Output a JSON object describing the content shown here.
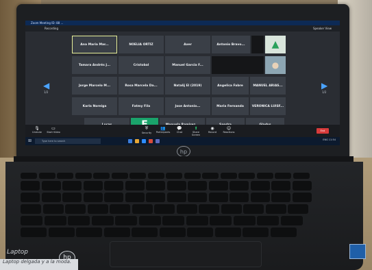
{
  "zoom": {
    "window_title": "Zoom Meeting ID: 88 ...",
    "recording_label": "Recording",
    "speaker_view_label": "Speaker View",
    "page_left": "1/2",
    "page_right": "1/2",
    "participants": [
      "Ana Maria Mar...",
      "NOELIA ORTIZ",
      "Axer",
      "Antonio Bravo...",
      "Tamara Andrés J...",
      "Cristobal",
      "Manuel Garcia F...",
      "Jorge Marcelo M...",
      "Rosa Marcela Da...",
      "Natalij El (2019)",
      "Angelica Fabre",
      "MANUEL ARIAS...",
      "Karla Noreiga",
      "Fatmy Fila",
      "Jose Antonio...",
      "Maria Fernanda",
      "VERONICA LUISF...",
      "Lucas",
      "E",
      "Manuela Ramirez...",
      "Sandra",
      "Gladys"
    ],
    "controls": [
      "Unmute",
      "Start Video",
      "Security",
      "Participants",
      "Chat",
      "Share Screen",
      "Record",
      "Reactions"
    ],
    "end_label": "End",
    "taskbar_search": "Type here to search",
    "tray_time": "ENG 11:54"
  },
  "laptop": {
    "brand_label": "Laptop",
    "sticker_text": "Laptop delgada y a la moda.",
    "logo_text": "hp"
  },
  "colors": {
    "zoom_blue": "#4aa3ff",
    "end_red": "#d83b3b",
    "active_border": "#e9f19a"
  }
}
